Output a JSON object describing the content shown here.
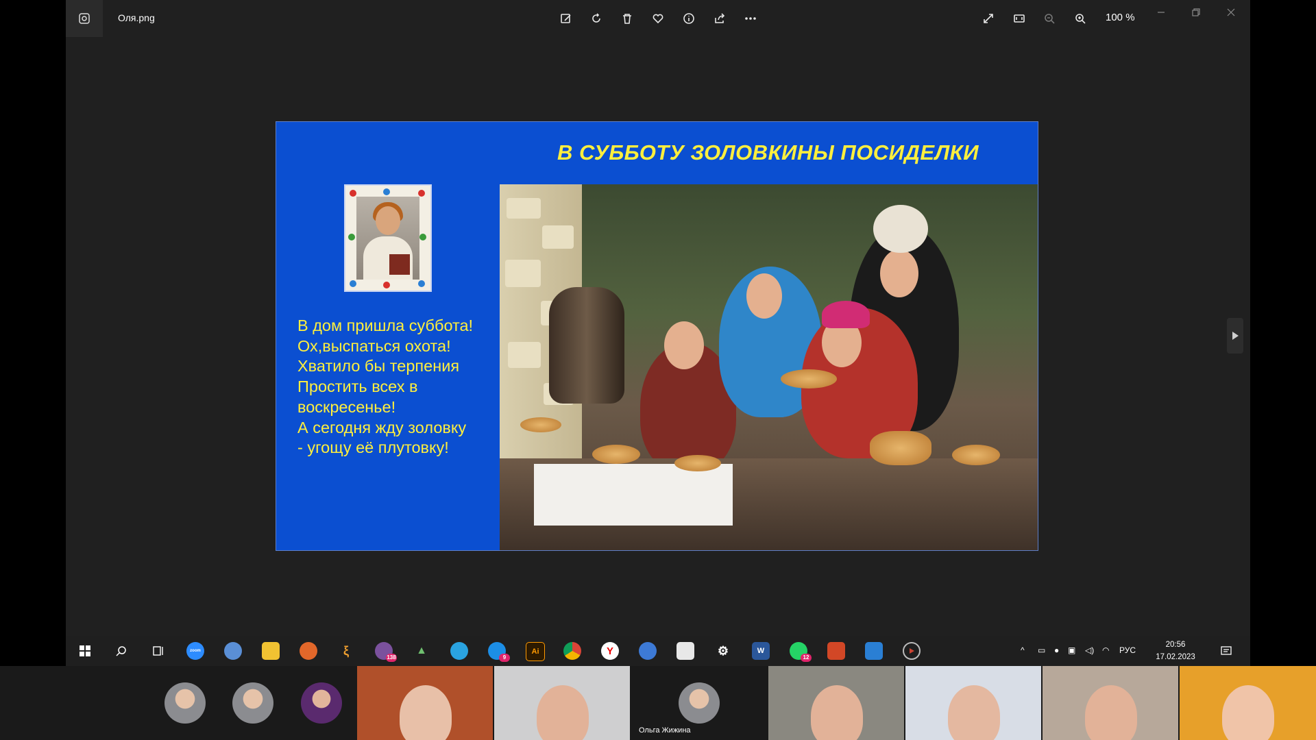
{
  "window": {
    "file_name": "Оля.png",
    "zoom_level": "100 %"
  },
  "toolbar": {
    "items": [
      "edit-image-icon",
      "rotate-icon",
      "delete-icon",
      "favorite-icon",
      "info-icon",
      "share-icon",
      "more-icon"
    ],
    "right_items": [
      "fullscreen-icon",
      "fit-to-window-icon",
      "zoom-out-icon",
      "zoom-in-icon"
    ]
  },
  "slide": {
    "title": "В СУББОТУ ЗОЛОВКИНЫ  ПОСИДЕЛКИ",
    "poem_lines": [
      "В дом пришла суббота!",
      "Ох,выспаться охота!",
      "Хватило бы терпения",
      "Простить всех в",
      "воскресенье!",
      "А сегодня жду золовку",
      "- угощу её плутовку!"
    ],
    "background_color": "#0b4fd1",
    "text_color": "#ffef3d"
  },
  "taskbar": {
    "badges": {
      "viber": "138",
      "skype": "9",
      "whatsapp": "12"
    },
    "language": "РУС",
    "time": "20:56",
    "date": "17.02.2023",
    "zoom_app_label": "zoom"
  },
  "video_strip": {
    "participant_name": "Ольга Жижина"
  }
}
